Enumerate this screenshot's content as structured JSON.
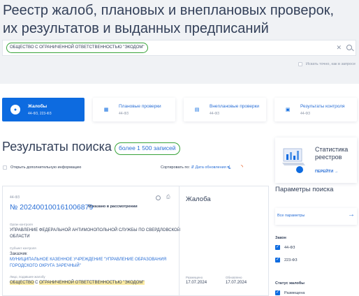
{
  "page": {
    "title": "Реестр жалоб, плановых и внеплановых проверок, их результатов и выданных предписаний"
  },
  "search": {
    "value": "ОБЩЕСТВО С ОГРАНИЧЕННОЙ ОТВЕТСТВЕННОСТЬЮ \"ЭКОДОМ\"",
    "clear_icon": "close-icon",
    "search_icon": "search-icon",
    "exact_label": "Искать точно, как в запросе"
  },
  "tabs": [
    {
      "label": "Жалобы",
      "sub": "44-ФЗ, 223-ФЗ",
      "icon": "chat-icon",
      "active": true
    },
    {
      "label": "Плановые проверки",
      "sub": "44-ФЗ",
      "icon": "calendar-icon",
      "active": false
    },
    {
      "label": "Внеплановые проверки",
      "sub": "44-ФЗ",
      "icon": "document-icon",
      "active": false
    },
    {
      "label": "Результаты контроля",
      "sub": "44-ФЗ",
      "icon": "briefcase-icon",
      "active": false
    }
  ],
  "results": {
    "title": "Результаты поиска",
    "count": "более 1 500 записей",
    "extra_info": "Открыть дополнительную информацию",
    "sort_label": "Сортировать по:",
    "sort_value": "Дата обновления"
  },
  "card": {
    "law": "44-ФЗ",
    "number": "№ 202400100161006879",
    "status": "Отказано в рассмотрении",
    "type": "Жалоба",
    "authority_label": "Орган контроля",
    "authority": "УПРАВЛЕНИЕ ФЕДЕРАЛЬНОЙ АНТИМОНОПОЛЬНОЙ СЛУЖБЫ ПО СВЕРДЛОВСКОЙ ОБЛАСТИ",
    "subject_label": "Субъект контроля",
    "subject_role": "Заказчик",
    "subject": "МУНИЦИПАЛЬНОЕ КАЗЕННОЕ УЧРЕЖДЕНИЕ \"УПРАВЛЕНИЕ ОБРАЗОВАНИЯ ГОРОДСКОГО ОКРУГА ЗАРЕЧНЫЙ\"",
    "complainant_label": "Лицо, подавшее жалобу",
    "complainant_prefix": "ОБЩЕСТВО",
    "complainant_mid": " С ",
    "complainant_highlight": "ОГРАНИЧЕННОЙ ОТВЕТСТВЕННОСТЬЮ \"ЭКОДОМ\"",
    "posted_label": "Размещено",
    "posted": "17.07.2024",
    "updated_label": "Обновлено",
    "updated": "17.07.2024"
  },
  "promo": {
    "title": "Статистика реестров",
    "link": "ПЕРЕЙТИ →"
  },
  "params": {
    "title": "Параметры поиска",
    "all_label": "Все параметры",
    "law_section": "Закон",
    "laws": [
      "44-ФЗ",
      "223-ФЗ"
    ],
    "status_section": "Статус жалобы",
    "statuses": [
      "Размещена"
    ]
  },
  "colors": {
    "accent": "#0d6be0",
    "highlight_border": "#38a33a",
    "mark": "#fbeaa1"
  }
}
